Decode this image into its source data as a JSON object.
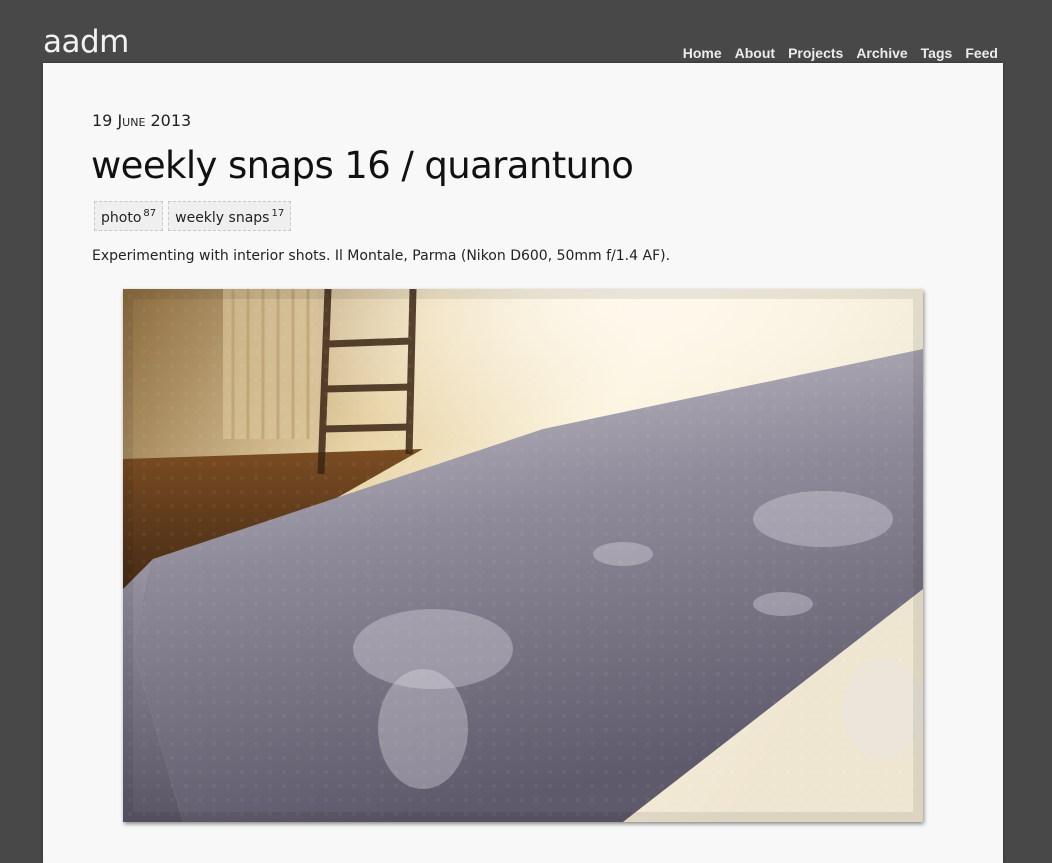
{
  "site": {
    "logo": "aadm"
  },
  "nav": {
    "items": [
      {
        "label": "Home",
        "key": "home"
      },
      {
        "label": "About",
        "key": "about"
      },
      {
        "label": "Projects",
        "key": "projects"
      },
      {
        "label": "Archive",
        "key": "archive"
      },
      {
        "label": "Tags",
        "key": "tags"
      },
      {
        "label": "Feed",
        "key": "feed"
      }
    ]
  },
  "post": {
    "date_day": "19",
    "date_month": "June",
    "date_year": "2013",
    "title": "weekly snaps 16 / quarantuno",
    "tags": [
      {
        "label": "photo",
        "count": "87"
      },
      {
        "label": "weekly snaps",
        "count": "17"
      }
    ],
    "body": "Experimenting with interior shots. Il Montale, Parma (Nikon D600, 50mm f/1.4 AF)."
  },
  "colors": {
    "page_background": "#484848",
    "panel_background": "#f8f8f8",
    "nav_text": "#ececec",
    "tag_background": "#efefef"
  }
}
